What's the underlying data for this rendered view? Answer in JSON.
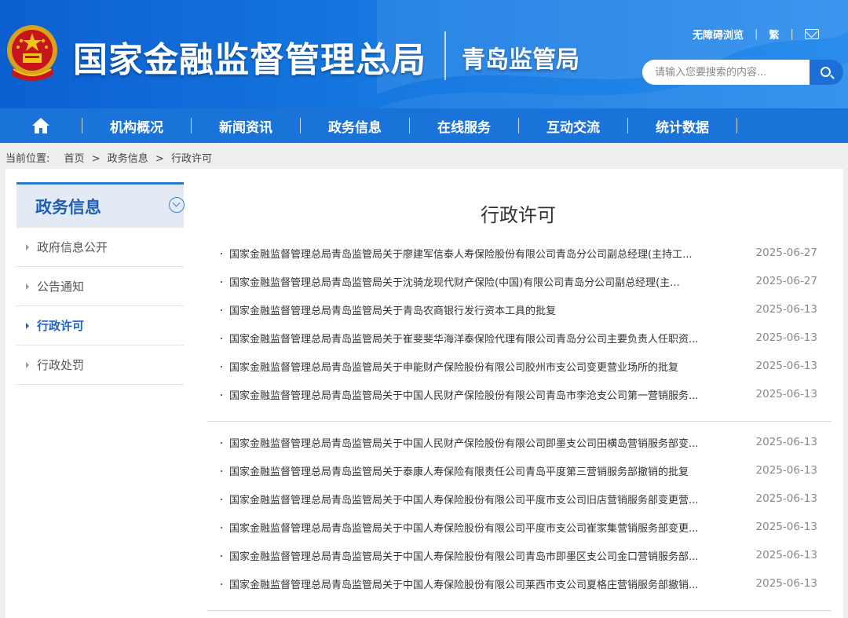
{
  "header": {
    "main_title": "国家金融监督管理总局",
    "sub_title": "青岛监管局",
    "top_links": [
      "无障碍浏览",
      "繁"
    ],
    "search_placeholder": "请输入您要搜索的内容...",
    "icons": [
      "national-emblem-icon",
      "mail-icon",
      "search-icon"
    ]
  },
  "nav": {
    "home_icon": "home-icon",
    "items": [
      "机构概况",
      "新闻资讯",
      "政务信息",
      "在线服务",
      "互动交流",
      "统计数据"
    ]
  },
  "breadcrumb": {
    "label": "当前位置:",
    "items": [
      "首页",
      "政务信息",
      "行政许可"
    ],
    "separator": ">"
  },
  "sidebar": {
    "title": "政务信息",
    "items": [
      {
        "label": "政府信息公开",
        "active": false
      },
      {
        "label": "公告通知",
        "active": false
      },
      {
        "label": "行政许可",
        "active": true
      },
      {
        "label": "行政处罚",
        "active": false
      }
    ]
  },
  "main": {
    "title": "行政许可",
    "groups": [
      [
        {
          "title": "国家金融监督管理总局青岛监管局关于廖建军信泰人寿保险股份有限公司青岛分公司副总经理(主持工...",
          "date": "2025-06-27"
        },
        {
          "title": "国家金融监督管理总局青岛监管局关于沈骑龙现代财产保险(中国)有限公司青岛分公司副总经理(主...",
          "date": "2025-06-27"
        },
        {
          "title": "国家金融监督管理总局青岛监管局关于青岛农商银行发行资本工具的批复",
          "date": "2025-06-13"
        },
        {
          "title": "国家金融监督管理总局青岛监管局关于崔斐斐华海洋泰保险代理有限公司青岛分公司主要负责人任职资...",
          "date": "2025-06-13"
        },
        {
          "title": "国家金融监督管理总局青岛监管局关于申能财产保险股份有限公司胶州市支公司变更营业场所的批复",
          "date": "2025-06-13"
        },
        {
          "title": "国家金融监督管理总局青岛监管局关于中国人民财产保险股份有限公司青岛市李沧支公司第一营销服务...",
          "date": "2025-06-13"
        }
      ],
      [
        {
          "title": "国家金融监督管理总局青岛监管局关于中国人民财产保险股份有限公司即墨支公司田横岛营销服务部变...",
          "date": "2025-06-13"
        },
        {
          "title": "国家金融监督管理总局青岛监管局关于泰康人寿保险有限责任公司青岛平度第三营销服务部撤销的批复",
          "date": "2025-06-13"
        },
        {
          "title": "国家金融监督管理总局青岛监管局关于中国人寿保险股份有限公司平度市支公司旧店营销服务部变更营...",
          "date": "2025-06-13"
        },
        {
          "title": "国家金融监督管理总局青岛监管局关于中国人寿保险股份有限公司平度市支公司崔家集营销服务部变更...",
          "date": "2025-06-13"
        },
        {
          "title": "国家金融监督管理总局青岛监管局关于中国人寿保险股份有限公司青岛市即墨区支公司金口营销服务部...",
          "date": "2025-06-13"
        },
        {
          "title": "国家金融监督管理总局青岛监管局关于中国人寿保险股份有限公司莱西市支公司夏格庄营销服务部撤销...",
          "date": "2025-06-13"
        }
      ]
    ]
  },
  "colors": {
    "header_blue": "#1678e0",
    "nav_blue": "#1a73d9",
    "active_blue": "#1e64c8"
  }
}
